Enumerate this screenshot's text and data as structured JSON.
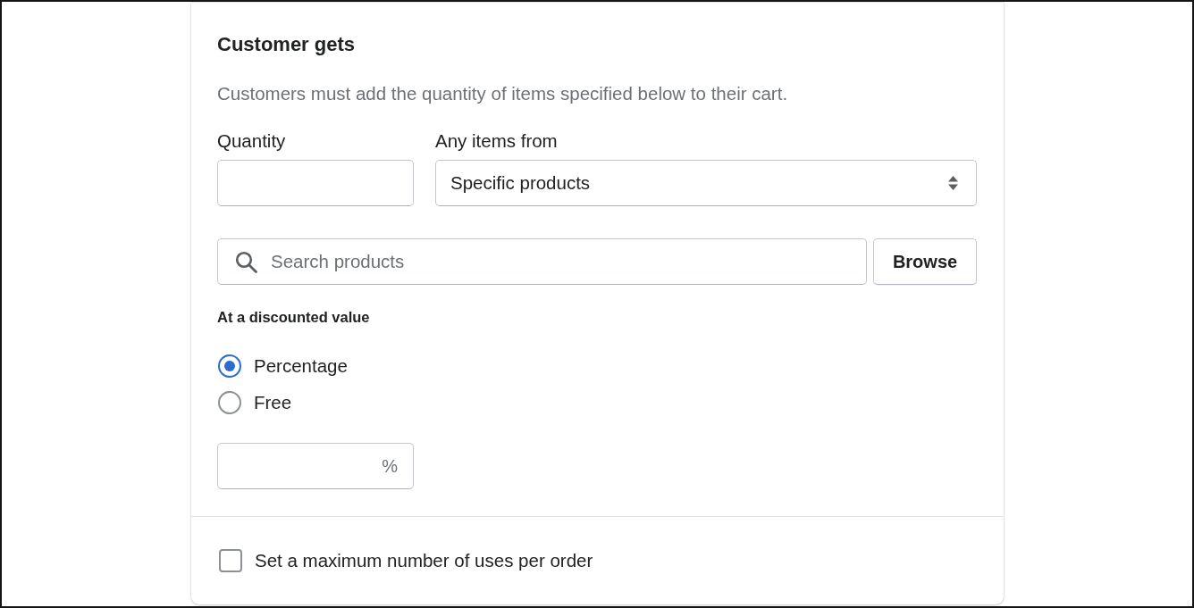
{
  "section": {
    "title": "Customer gets",
    "description": "Customers must add the quantity of items specified below to their cart."
  },
  "quantity": {
    "label": "Quantity"
  },
  "items_from": {
    "label": "Any items from",
    "value": "Specific products"
  },
  "search": {
    "placeholder": "Search products",
    "button": "Browse"
  },
  "discount": {
    "label": "At a discounted value",
    "options": [
      {
        "label": "Percentage",
        "selected": true
      },
      {
        "label": "Free",
        "selected": false
      }
    ],
    "suffix": "%"
  },
  "max_uses": {
    "label": "Set a maximum number of uses per order",
    "checked": false
  }
}
